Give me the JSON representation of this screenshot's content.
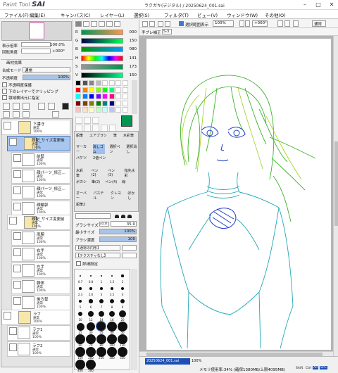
{
  "app": {
    "logo_small": "Paint Tool",
    "logo_big": "SAI",
    "window_title": "ラクガキ(デジタル) / 20250624_001.sai"
  },
  "menu": [
    "ファイル(F)",
    "編集(E)",
    "キャンバス(C)",
    "レイヤー(L)",
    "選択(S)",
    "フィルタ(T)",
    "ビュー(V)",
    "ウィンドウ(W)",
    "その他(O)"
  ],
  "navigator": {
    "zoom_label": "表示倍率",
    "zoom_value": "100.0%",
    "angle_label": "回転角度",
    "angle_value": "+000°"
  },
  "layer_props": {
    "header": "画材効果",
    "mode_label": "合成モード",
    "mode_value": "通常",
    "opacity_label": "不透明度",
    "opacity_value": "100%",
    "protect": "不透明度保護",
    "clip": "下のレイヤーでクリッピング",
    "source": "領域検出元に指定"
  },
  "layers": [
    {
      "name": "下書き",
      "mode": "通常",
      "opacity": "100%",
      "type": "folder"
    },
    {
      "name": "顔配_サイズ変更後",
      "mode": "通常",
      "opacity": "100%",
      "type": "folder",
      "selected": true
    },
    {
      "name": "前髪",
      "mode": "通常",
      "opacity": "100%",
      "type": "layer"
    },
    {
      "name": "顔パーツ_修正...",
      "mode": "通常",
      "opacity": "100%",
      "type": "layer"
    },
    {
      "name": "顔パーツ_修正...",
      "mode": "通常",
      "opacity": "100%",
      "type": "layer"
    },
    {
      "name": "顔輪郭",
      "mode": "通常",
      "opacity": "100%",
      "type": "layer"
    },
    {
      "name": "顔配_サイズ変更前",
      "mode": "通常",
      "opacity": "100%",
      "type": "folder"
    },
    {
      "name": "両腕",
      "mode": "通常",
      "opacity": "100%",
      "type": "layer"
    },
    {
      "name": "右手",
      "mode": "通常",
      "opacity": "100%",
      "type": "layer"
    },
    {
      "name": "左手",
      "mode": "通常",
      "opacity": "100%",
      "type": "layer"
    },
    {
      "name": "胴体",
      "mode": "通常",
      "opacity": "100%",
      "type": "layer"
    },
    {
      "name": "後ろ髪",
      "mode": "通常",
      "opacity": "100%",
      "type": "layer"
    },
    {
      "name": "ラフ",
      "mode": "通常",
      "opacity": "100%",
      "type": "folder"
    },
    {
      "name": "ラフ1",
      "mode": "通常",
      "opacity": "100%",
      "type": "layer"
    },
    {
      "name": "ラフ2",
      "mode": "通常",
      "opacity": "100%",
      "type": "layer"
    }
  ],
  "color": {
    "r_label": "R",
    "r": "000",
    "g_label": "G",
    "g": "150",
    "b_label": "B",
    "b": "080",
    "h_label": "H",
    "h": "141",
    "s_label": "S",
    "s": "173",
    "v_label": "V",
    "v": "150",
    "current": "#009650"
  },
  "tools": {
    "row1": [
      "鉛筆",
      "エアブラシ",
      "筆",
      "水彩筆"
    ],
    "row2": [
      "マーカー",
      "消しゴム",
      "選択ペン",
      "選択消し"
    ],
    "row3": [
      "バケツ",
      "2値ペン"
    ],
    "row4": [
      "水彩筆",
      "ペン(2)",
      "ペン(3)",
      "指先水彩"
    ],
    "row5": [
      "ボカシ",
      "筆(2)",
      "ペン(4)",
      "線"
    ],
    "row6": [
      "オーバー",
      "パステル",
      "クレヨン",
      "ぼかし"
    ],
    "row7": [
      "鉛筆2"
    ]
  },
  "brush": {
    "size_label": "ブラシサイズ",
    "size_mult": "x1.0",
    "size_value": "35.0",
    "min_label": "最小サイズ",
    "min_value": "100%",
    "density_label": "ブラシ濃度",
    "density_value": "100",
    "shape_label": "【通常の円形】",
    "texture_label": "【テクスチャなし】",
    "detail_label": "詳細設定"
  },
  "brush_sizes": [
    "0.7",
    "0.8",
    "1",
    "1.5",
    "2",
    "2.3",
    "2.6",
    "3",
    "3.5",
    "4",
    "5",
    "6",
    "7",
    "8",
    "9",
    "10",
    "12",
    "14",
    "16",
    "20",
    "25",
    "30",
    "35",
    "40",
    "50",
    "60",
    "70",
    "80",
    "100",
    "120",
    "160",
    "200",
    "250",
    "300",
    "350",
    "400",
    "500"
  ],
  "toolbar": {
    "stab_label": "手ブレ補正",
    "stab_value": "S-3",
    "show_sel_label": "選択範囲表示",
    "zoom": "100%",
    "angle": "+000°",
    "mode": "通常"
  },
  "status": {
    "tab": "20250624_001.sai",
    "zoom": "100%",
    "memory": "メモリ使用率:34% (確保1380MB/上限4095MB)",
    "keys": [
      "Shift",
      "Ctrl",
      "Alt",
      "SPC"
    ]
  }
}
